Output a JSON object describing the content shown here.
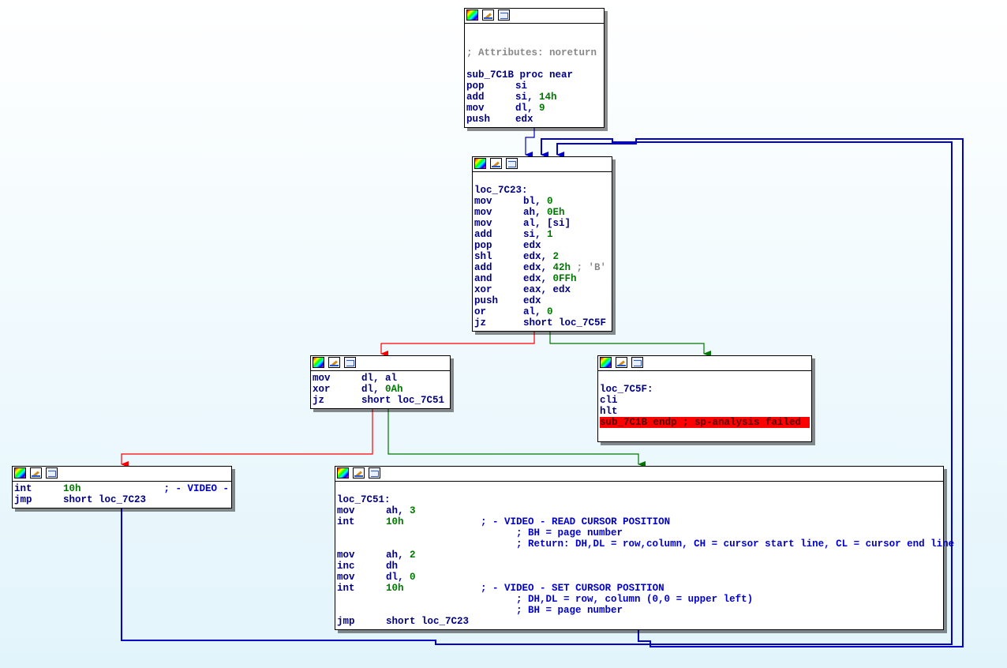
{
  "nodes": {
    "n1": {
      "comment": "; Attributes: noreturn",
      "proc": "sub_7C1B proc near",
      "lines": [
        {
          "mn": "pop",
          "op": "si"
        },
        {
          "mn": "add",
          "op": "si, ",
          "num": "14h"
        },
        {
          "mn": "mov",
          "op": "dl, ",
          "num": "9"
        },
        {
          "mn": "push",
          "op": "edx"
        }
      ]
    },
    "n2": {
      "label": "loc_7C23:",
      "lines": [
        {
          "mn": "mov",
          "op": "bl, ",
          "num": "0"
        },
        {
          "mn": "mov",
          "op": "ah, ",
          "num": "0Eh"
        },
        {
          "mn": "mov",
          "op": "al, [si]"
        },
        {
          "mn": "add",
          "op": "si, ",
          "num": "1"
        },
        {
          "mn": "pop",
          "op": "edx"
        },
        {
          "mn": "shl",
          "op": "edx, ",
          "num": "2"
        },
        {
          "mn": "add",
          "op": "edx, ",
          "num": "42h",
          "cm": " ; 'B'"
        },
        {
          "mn": "and",
          "op": "edx, ",
          "num": "0FFh"
        },
        {
          "mn": "xor",
          "op": "eax, edx"
        },
        {
          "mn": "push",
          "op": "edx"
        },
        {
          "mn": "or",
          "op": "al, ",
          "num": "0"
        },
        {
          "mn": "jz",
          "op": "short loc_7C5F"
        }
      ]
    },
    "n3": {
      "lines": [
        {
          "mn": "mov",
          "op": "dl, al"
        },
        {
          "mn": "xor",
          "op": "dl, ",
          "num": "0Ah"
        },
        {
          "mn": "jz",
          "op": "short loc_7C51"
        }
      ]
    },
    "n4": {
      "label": "loc_7C5F:",
      "lines": [
        {
          "mn": "cli",
          "op": ""
        },
        {
          "mn": "hlt",
          "op": ""
        }
      ],
      "endp": "sub_7C1B endp ; sp-analysis failed"
    },
    "n5": {
      "lines": [
        {
          "mn": "int",
          "op": "",
          "num": "10h",
          "pad": "              ",
          "vc": "; - VIDEO -"
        },
        {
          "mn": "jmp",
          "op": "short loc_7C23"
        }
      ]
    },
    "n6": {
      "label": "loc_7C51:",
      "lines": [
        {
          "mn": "mov",
          "op": "ah, ",
          "num": "3"
        },
        {
          "mn": "int",
          "op": "",
          "num": "10h",
          "pad": "             ",
          "vc": "; - VIDEO - READ CURSOR POSITION"
        },
        {
          "mn": "",
          "op": "",
          "pad": "                      ",
          "vc": "; BH = page number"
        },
        {
          "mn": "",
          "op": "",
          "pad": "                      ",
          "vc": "; Return: DH,DL = row,column, CH = cursor start line, CL = cursor end line"
        },
        {
          "mn": "mov",
          "op": "ah, ",
          "num": "2"
        },
        {
          "mn": "inc",
          "op": "dh"
        },
        {
          "mn": "mov",
          "op": "dl, ",
          "num": "0"
        },
        {
          "mn": "int",
          "op": "",
          "num": "10h",
          "pad": "             ",
          "vc": "; - VIDEO - SET CURSOR POSITION"
        },
        {
          "mn": "",
          "op": "",
          "pad": "                      ",
          "vc": "; DH,DL = row, column (0,0 = upper left)"
        },
        {
          "mn": "",
          "op": "",
          "pad": "                      ",
          "vc": "; BH = page number"
        },
        {
          "mn": "jmp",
          "op": "short loc_7C23"
        }
      ]
    }
  },
  "colors": {
    "edge_normal": "#0000cc",
    "edge_true": "#007700",
    "edge_false": "#ff0000",
    "highlight": "#ff0000"
  },
  "icons": [
    "color-picker-icon",
    "rename-icon",
    "graph-view-icon"
  ]
}
